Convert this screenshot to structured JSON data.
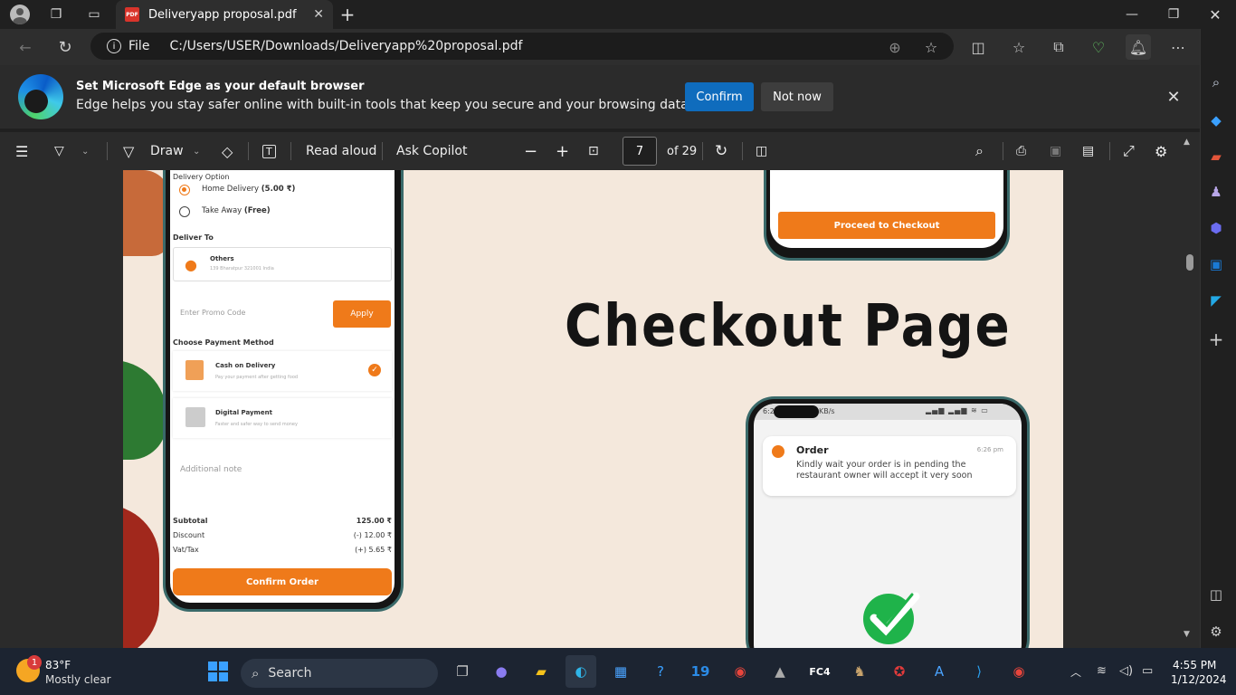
{
  "tab": {
    "title": "Deliveryapp proposal.pdf",
    "pdf_badge": "PDF"
  },
  "address": {
    "scheme_label": "File",
    "url": "C:/Users/USER/Downloads/Deliveryapp%20proposal.pdf"
  },
  "banner": {
    "title": "Set Microsoft Edge as your default browser",
    "text": "Edge helps you stay safer online with built-in tools that keep you secure and your browsing data private",
    "confirm_label": "Confirm",
    "not_now_label": "Not now"
  },
  "pdf_toolbar": {
    "draw_label": "Draw",
    "read_aloud_label": "Read aloud",
    "ask_copilot_label": "Ask Copilot",
    "page_number": "7",
    "page_total": "of 29"
  },
  "pdf_content": {
    "headline": "Checkout Page",
    "phone1": {
      "delivery_option_label": "Delivery Option",
      "home_delivery": "Home Delivery",
      "home_delivery_price": "(5.00 ₹)",
      "take_away": "Take Away",
      "take_away_price": "(Free)",
      "deliver_to_label": "Deliver To",
      "address_title": "Others",
      "address_sub": "139 Bharatpur 321001 India",
      "promo_placeholder": "Enter Promo Code",
      "apply_label": "Apply",
      "payment_method_label": "Choose Payment Method",
      "cod_title": "Cash on Delivery",
      "cod_sub": "Pay your payment after getting food",
      "digital_title": "Digital Payment",
      "digital_sub": "Faster and safer way to send money",
      "additional_note": "Additional note",
      "subtotal_label": "Subtotal",
      "subtotal_value": "125.00 ₹",
      "discount_label": "Discount",
      "discount_value": "(-) 12.00 ₹",
      "vat_label": "Vat/Tax",
      "vat_value": "(+) 5.65 ₹",
      "confirm_order_label": "Confirm Order"
    },
    "phone2": {
      "checkout_label": "Proceed to Checkout"
    },
    "phone3": {
      "status_time": "6:2",
      "status_speed": "KB/s",
      "notif_title": "Order",
      "notif_time": "6:26 pm",
      "notif_line1": "Kindly wait your order is in pending the",
      "notif_line2": "restaurant owner will accept it very soon"
    }
  },
  "taskbar": {
    "weather_temp": "83°F",
    "weather_text": "Mostly clear",
    "weather_badge": "1",
    "search_label": "Search",
    "time": "4:55 PM",
    "date": "1/12/2024"
  },
  "colors": {
    "accent_orange": "#ef7a1a",
    "edge_blue": "#0f6cbd"
  }
}
